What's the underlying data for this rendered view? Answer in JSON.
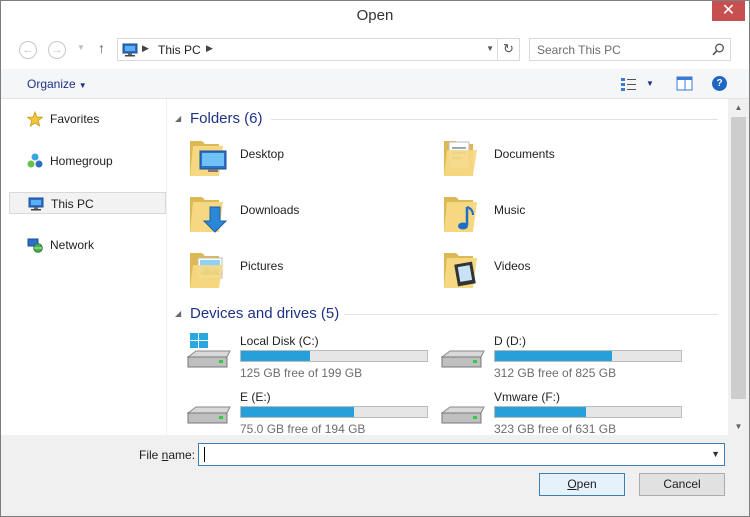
{
  "window": {
    "title": "Open",
    "close_label": "✕"
  },
  "address": {
    "crumb": "This PC"
  },
  "search": {
    "placeholder": "Search This PC"
  },
  "toolbar": {
    "organize_label": "Organize"
  },
  "nav": [
    {
      "label": "Favorites"
    },
    {
      "label": "Homegroup"
    },
    {
      "label": "This PC"
    },
    {
      "label": "Network"
    }
  ],
  "folders_group": {
    "title": "Folders (6)"
  },
  "folders": [
    {
      "label": "Desktop"
    },
    {
      "label": "Documents"
    },
    {
      "label": "Downloads"
    },
    {
      "label": "Music"
    },
    {
      "label": "Pictures"
    },
    {
      "label": "Videos"
    }
  ],
  "drives_group": {
    "title": "Devices and drives (5)"
  },
  "drives": [
    {
      "name": "Local Disk (C:)",
      "free": "125 GB free of 199 GB",
      "used_fraction": 0.37
    },
    {
      "name": "D (D:)",
      "free": "312 GB free of 825 GB",
      "used_fraction": 0.63
    },
    {
      "name": "E (E:)",
      "free": "75.0 GB free of 194 GB",
      "used_fraction": 0.61
    },
    {
      "name": "Vmware (F:)",
      "free": "323 GB free of 631 GB",
      "used_fraction": 0.49
    }
  ],
  "bottom": {
    "file_name_label_pre": "File ",
    "file_name_label_accel": "n",
    "file_name_label_post": "ame:",
    "file_name_value": "",
    "open_accel": "O",
    "open_rest": "pen",
    "cancel_label": "Cancel"
  }
}
